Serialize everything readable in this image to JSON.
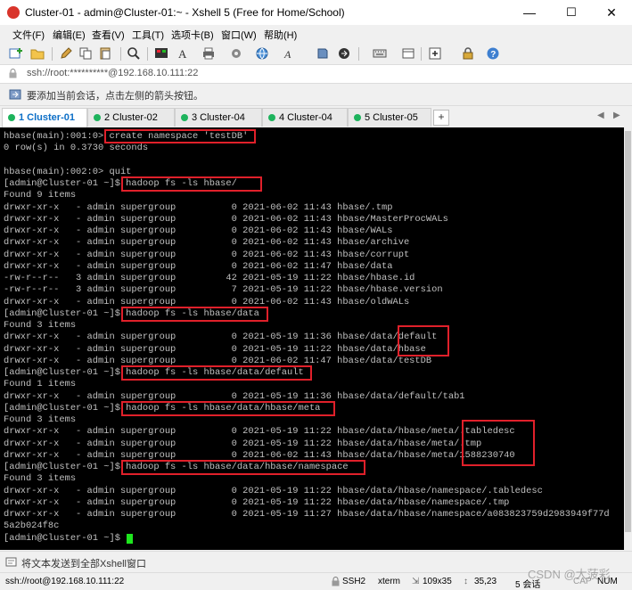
{
  "window": {
    "title": "Cluster-01 - admin@Cluster-01:~ - Xshell 5 (Free for Home/School)",
    "controls": {
      "minimize": "—",
      "maximize": "☐",
      "close": "✕"
    }
  },
  "menu": [
    "文件(F)",
    "编辑(E)",
    "查看(V)",
    "工具(T)",
    "选项卡(B)",
    "窗口(W)",
    "帮助(H)"
  ],
  "toolbar_icons": [
    "new-session-icon",
    "open-folder-icon",
    "edit-icon",
    "copy-icon",
    "paste-icon",
    "find-icon",
    "color-scheme-icon",
    "font-icon",
    "globe-icon",
    "print-icon",
    "settings-icon",
    "keyboard-icon",
    "add-icon",
    "lock-icon",
    "help-icon"
  ],
  "address": {
    "text": "ssh://root:**********@192.168.10.111:22"
  },
  "hint": {
    "text": "要添加当前会话，点击左侧的箭头按钮。"
  },
  "tabs": [
    {
      "label": "1 Cluster-01",
      "color": "#1db35c",
      "active": true
    },
    {
      "label": "2 Cluster-02",
      "color": "#1db35c",
      "active": false
    },
    {
      "label": "3 Cluster-04",
      "color": "#1db35c",
      "active": false
    },
    {
      "label": "4 Cluster-04",
      "color": "#1db35c",
      "active": false
    },
    {
      "label": "5 Cluster-05",
      "color": "#1db35c",
      "active": false
    }
  ],
  "tab_add": "+",
  "tab_nav": {
    "prev": "◀",
    "next": "▶"
  },
  "terminal": {
    "lines": [
      "hbase(main):001:0> create namespace 'testDB'",
      "0 row(s) in 0.3730 seconds",
      "",
      "hbase(main):002:0> quit",
      "[admin@Cluster-01 ~]$ hadoop fs -ls hbase/",
      "Found 9 items",
      "drwxr-xr-x   - admin supergroup          0 2021-06-02 11:43 hbase/.tmp",
      "drwxr-xr-x   - admin supergroup          0 2021-06-02 11:43 hbase/MasterProcWALs",
      "drwxr-xr-x   - admin supergroup          0 2021-06-02 11:43 hbase/WALs",
      "drwxr-xr-x   - admin supergroup          0 2021-06-02 11:43 hbase/archive",
      "drwxr-xr-x   - admin supergroup          0 2021-06-02 11:43 hbase/corrupt",
      "drwxr-xr-x   - admin supergroup          0 2021-06-02 11:47 hbase/data",
      "-rw-r--r--   3 admin supergroup         42 2021-05-19 11:22 hbase/hbase.id",
      "-rw-r--r--   3 admin supergroup          7 2021-05-19 11:22 hbase/hbase.version",
      "drwxr-xr-x   - admin supergroup          0 2021-06-02 11:43 hbase/oldWALs",
      "[admin@Cluster-01 ~]$ hadoop fs -ls hbase/data",
      "Found 3 items",
      "drwxr-xr-x   - admin supergroup          0 2021-05-19 11:36 hbase/data/default",
      "drwxr-xr-x   - admin supergroup          0 2021-05-19 11:22 hbase/data/hbase",
      "drwxr-xr-x   - admin supergroup          0 2021-06-02 11:47 hbase/data/testDB",
      "[admin@Cluster-01 ~]$ hadoop fs -ls hbase/data/default",
      "Found 1 items",
      "drwxr-xr-x   - admin supergroup          0 2021-05-19 11:36 hbase/data/default/tab1",
      "[admin@Cluster-01 ~]$ hadoop fs -ls hbase/data/hbase/meta",
      "Found 3 items",
      "drwxr-xr-x   - admin supergroup          0 2021-05-19 11:22 hbase/data/hbase/meta/.tabledesc",
      "drwxr-xr-x   - admin supergroup          0 2021-05-19 11:22 hbase/data/hbase/meta/.tmp",
      "drwxr-xr-x   - admin supergroup          0 2021-06-02 11:43 hbase/data/hbase/meta/1588230740",
      "[admin@Cluster-01 ~]$ hadoop fs -ls hbase/data/hbase/namespace",
      "Found 3 items",
      "drwxr-xr-x   - admin supergroup          0 2021-05-19 11:22 hbase/data/hbase/namespace/.tabledesc",
      "drwxr-xr-x   - admin supergroup          0 2021-05-19 11:22 hbase/data/hbase/namespace/.tmp",
      "drwxr-xr-x   - admin supergroup          0 2021-05-19 11:27 hbase/data/hbase/namespace/a083823759d2983949f77d",
      "5a2b024f8c",
      "[admin@Cluster-01 ~]$ "
    ],
    "text_color": "#c0c0c0",
    "background": "#000000",
    "highlight_color": "#e0202a",
    "cursor_color": "#1ee61e"
  },
  "send_bar": {
    "text": "将文本发送到全部Xshell窗口"
  },
  "status": {
    "connection": "ssh://root@192.168.10.111:22",
    "protocol": "SSH2",
    "terminal_type": "xterm",
    "size": "109x35",
    "cursor": "35,23",
    "sessions": "5 会话",
    "caps": "CAP",
    "num": "NUM"
  },
  "watermark": "CSDN @大菠彩"
}
